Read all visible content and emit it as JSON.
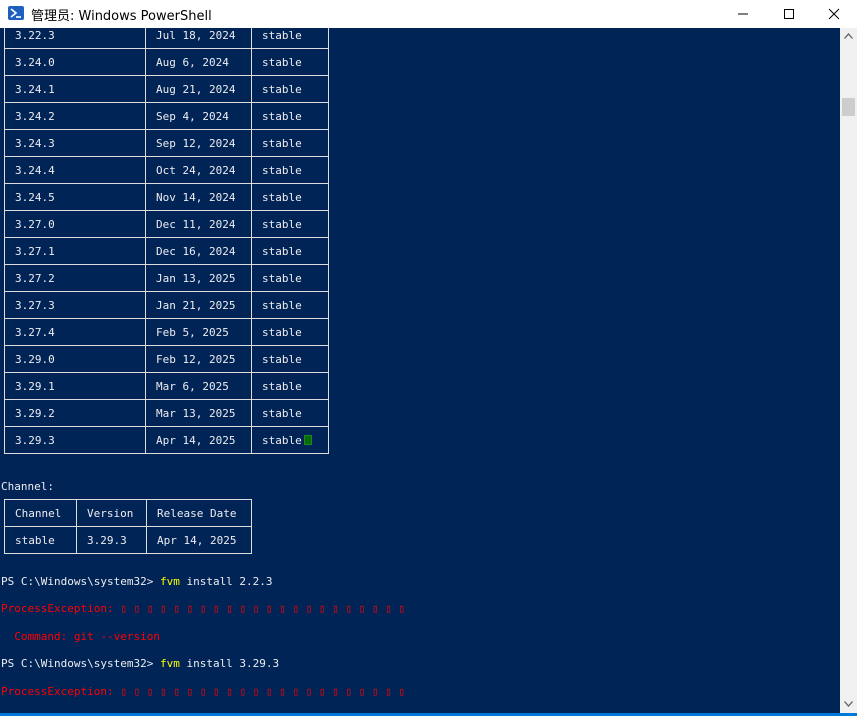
{
  "window": {
    "title": "管理员: Windows PowerShell",
    "accent": "#012456",
    "controls": {
      "minimize_icon": "minimize-icon",
      "maximize_icon": "maximize-icon",
      "close_icon": "close-icon"
    }
  },
  "releases": [
    {
      "version": "3.22.3",
      "date": "Jul 18, 2024",
      "channel": "stable"
    },
    {
      "version": "3.24.0",
      "date": "Aug 6, 2024",
      "channel": "stable"
    },
    {
      "version": "3.24.1",
      "date": "Aug 21, 2024",
      "channel": "stable"
    },
    {
      "version": "3.24.2",
      "date": "Sep 4, 2024",
      "channel": "stable"
    },
    {
      "version": "3.24.3",
      "date": "Sep 12, 2024",
      "channel": "stable"
    },
    {
      "version": "3.24.4",
      "date": "Oct 24, 2024",
      "channel": "stable"
    },
    {
      "version": "3.24.5",
      "date": "Nov 14, 2024",
      "channel": "stable"
    },
    {
      "version": "3.27.0",
      "date": "Dec 11, 2024",
      "channel": "stable"
    },
    {
      "version": "3.27.1",
      "date": "Dec 16, 2024",
      "channel": "stable"
    },
    {
      "version": "3.27.2",
      "date": "Jan 13, 2025",
      "channel": "stable"
    },
    {
      "version": "3.27.3",
      "date": "Jan 21, 2025",
      "channel": "stable"
    },
    {
      "version": "3.27.4",
      "date": "Feb 5, 2025",
      "channel": "stable"
    },
    {
      "version": "3.29.0",
      "date": "Feb 12, 2025",
      "channel": "stable"
    },
    {
      "version": "3.29.1",
      "date": "Mar 6, 2025",
      "channel": "stable"
    },
    {
      "version": "3.29.2",
      "date": "Mar 13, 2025",
      "channel": "stable"
    },
    {
      "version": "3.29.3",
      "date": "Apr 14, 2025",
      "channel": "stable"
    }
  ],
  "channel_section": {
    "label": "Channel:",
    "headers": [
      "Channel",
      "Version",
      "Release Date"
    ],
    "row": [
      "stable",
      "3.29.3",
      "Apr 14, 2025"
    ]
  },
  "commands": [
    {
      "prompt": "PS C:\\Windows\\system32> ",
      "cmd": "fvm",
      "args": " install 2.2.3",
      "error": "ProcessException: ",
      "error_glyphs": "▯ ▯ ▯ ▯ ▯ ▯ ▯ ▯ ▯ ▯ ▯ ▯ ▯ ▯ ▯ ▯ ▯ ▯ ▯ ▯ ▯ ▯",
      "detail": "  Command: git --version"
    },
    {
      "prompt": "PS C:\\Windows\\system32> ",
      "cmd": "fvm",
      "args": " install 3.29.3",
      "error": "ProcessException: ",
      "error_glyphs": "▯ ▯ ▯ ▯ ▯ ▯ ▯ ▯ ▯ ▯ ▯ ▯ ▯ ▯ ▯ ▯ ▯ ▯ ▯ ▯ ▯ ▯"
    }
  ],
  "colors": {
    "background": "#012456",
    "text": "#eeedf0",
    "command": "#ffff00",
    "error": "#ff0000"
  }
}
